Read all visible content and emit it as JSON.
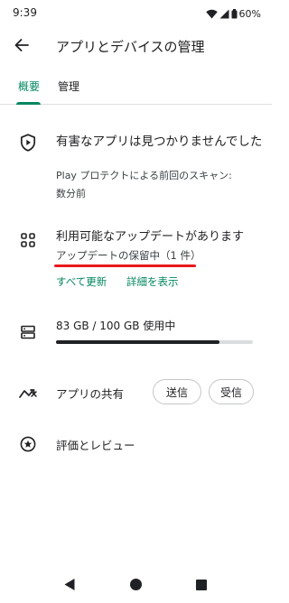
{
  "status_bar": {
    "time": "9:39",
    "battery_percent": "60%"
  },
  "app_bar": {
    "title": "アプリとデバイスの管理"
  },
  "tabs": [
    {
      "label": "概要",
      "active": true
    },
    {
      "label": "管理",
      "active": false
    }
  ],
  "play_protect": {
    "title": "有害なアプリは見つかりませんでした",
    "subtitle_line1": "Play プロテクトによる前回のスキャン:",
    "subtitle_line2": "数分前"
  },
  "updates": {
    "title": "利用可能なアップデートがあります",
    "pending": "アップデートの保留中（1 件）",
    "update_all_label": "すべて更新",
    "show_details_label": "詳細を表示"
  },
  "storage": {
    "usage_text": "83 GB / 100 GB 使用中",
    "used_fraction": 0.83
  },
  "share": {
    "label": "アプリの共有",
    "send_label": "送信",
    "receive_label": "受信"
  },
  "reviews": {
    "label": "評価とレビュー"
  },
  "colors": {
    "accent": "#01875f",
    "highlight": "#e8191c",
    "text": "#202124"
  },
  "icons": {
    "back": "arrow-back-icon",
    "protect": "play-protect-shield-icon",
    "updates": "apps-grid-icon",
    "storage": "storage-icon",
    "share": "share-apps-icon",
    "reviews": "star-circle-icon"
  }
}
